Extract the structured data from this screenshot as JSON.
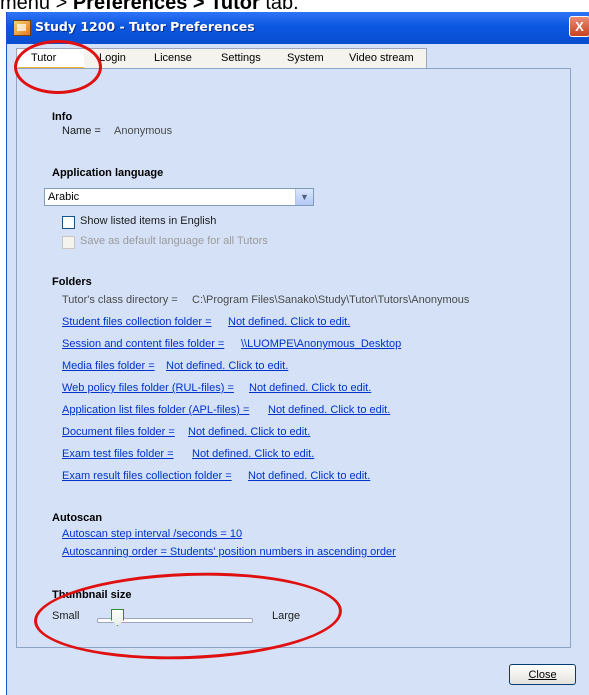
{
  "caption": {
    "prefix": "menu > ",
    "bold1": "Preferences",
    "sep": " > ",
    "bold2": "Tutor",
    "suffix": " tab."
  },
  "window": {
    "title": "Study 1200 - Tutor Preferences",
    "close_glyph": "X"
  },
  "tabs": [
    "Tutor",
    "Login",
    "License",
    "Settings",
    "System",
    "Video stream"
  ],
  "info": {
    "heading": "Info",
    "name_label": "Name =",
    "name_value": "Anonymous"
  },
  "language": {
    "heading": "Application language",
    "selected": "Arabic",
    "show_english_label": "Show listed items in English",
    "show_english_checked": false,
    "save_default_label": "Save as default language for all Tutors",
    "save_default_enabled": false
  },
  "folders": {
    "heading": "Folders",
    "class_dir_label": "Tutor's class directory =",
    "class_dir_value": "C:\\Program Files\\Sanako\\Study\\Tutor\\Tutors\\Anonymous",
    "items": [
      {
        "label": "Student files collection folder =",
        "value": "Not defined. Click to edit."
      },
      {
        "label": "Session and content files folder =",
        "value": "\\\\LUOMPE\\Anonymous_Desktop"
      },
      {
        "label": "Media files folder =",
        "value": "Not defined. Click to edit."
      },
      {
        "label": "Web policy files folder (RUL-files) =",
        "value": "Not defined. Click to edit."
      },
      {
        "label": "Application list files folder (APL-files) =",
        "value": "Not defined. Click to edit."
      },
      {
        "label": "Document files folder =",
        "value": "Not defined. Click to edit."
      },
      {
        "label": "Exam test files folder =",
        "value": "Not defined. Click to edit."
      },
      {
        "label": "Exam result files collection folder =",
        "value": "Not defined. Click to edit."
      }
    ]
  },
  "autoscan": {
    "heading": "Autoscan",
    "interval_link": "Autoscan step interval /seconds = 10",
    "order_link": "Autoscanning order = Students' position numbers in ascending order"
  },
  "thumbnail": {
    "heading": "Thumbnail size",
    "min_label": "Small",
    "max_label": "Large",
    "level_fraction": 0.13
  },
  "footer": {
    "close_label": "Close"
  },
  "colors": {
    "annotation": "#e01010",
    "link": "#0033cc",
    "panel": "#d4e1f6",
    "titlebar": "#0b57e0"
  }
}
